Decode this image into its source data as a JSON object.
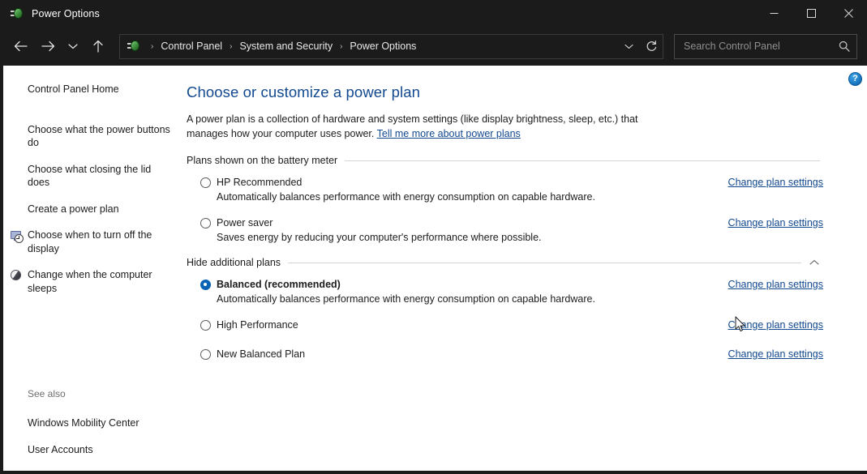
{
  "window": {
    "title": "Power Options",
    "app_icon": "power-plug-icon",
    "controls": {
      "minimize": "minimize-icon",
      "maximize": "maximize-icon",
      "close": "close-icon"
    }
  },
  "addressbar": {
    "back": "back-arrow-icon",
    "forward": "forward-arrow-icon",
    "recent": "chevron-down-icon",
    "up": "up-arrow-icon",
    "breadcrumb": [
      "Control Panel",
      "System and Security",
      "Power Options"
    ],
    "separator": "›",
    "dropdown": "chevron-down-icon",
    "refresh": "refresh-icon",
    "search": {
      "value": "",
      "placeholder": "Search Control Panel",
      "icon": "search-icon"
    }
  },
  "sidebar": {
    "home": "Control Panel Home",
    "items": [
      {
        "label": "Choose what the power buttons do",
        "icon": null
      },
      {
        "label": "Choose what closing the lid does",
        "icon": null
      },
      {
        "label": "Create a power plan",
        "icon": null
      },
      {
        "label": "Choose when to turn off the display",
        "icon": "display-clock-icon"
      },
      {
        "label": "Change when the computer sleeps",
        "icon": "moon-sleep-icon"
      }
    ],
    "see_also": {
      "title": "See also",
      "links": [
        "Windows Mobility Center",
        "User Accounts"
      ]
    }
  },
  "main": {
    "title": "Choose or customize a power plan",
    "intro_text": "A power plan is a collection of hardware and system settings (like display brightness, sleep, etc.) that manages how your computer uses power. ",
    "intro_link": "Tell me more about power plans",
    "help_button": "?",
    "sections": [
      {
        "label": "Plans shown on the battery meter",
        "collapsible": false,
        "chevron": null,
        "plans": [
          {
            "name": "HP Recommended",
            "selected": false,
            "bold": false,
            "description": "Automatically balances performance with energy consumption on capable hardware.",
            "link": "Change plan settings"
          },
          {
            "name": "Power saver",
            "selected": false,
            "bold": false,
            "description": "Saves energy by reducing your computer's performance where possible.",
            "link": "Change plan settings"
          }
        ]
      },
      {
        "label": "Hide additional plans",
        "collapsible": true,
        "chevron": "chevron-up-icon",
        "plans": [
          {
            "name": "Balanced (recommended)",
            "selected": true,
            "bold": true,
            "description": "Automatically balances performance with energy consumption on capable hardware.",
            "link": "Change plan settings"
          },
          {
            "name": "High Performance",
            "selected": false,
            "bold": false,
            "description": "",
            "link": "Change plan settings"
          },
          {
            "name": "New Balanced Plan",
            "selected": false,
            "bold": false,
            "description": "",
            "link": "Change plan settings"
          }
        ]
      }
    ]
  },
  "colors": {
    "accent_link": "#12488f",
    "radio_selected": "#0a63b5",
    "chrome_bg": "#1b1b1b",
    "content_bg": "#ffffff"
  }
}
